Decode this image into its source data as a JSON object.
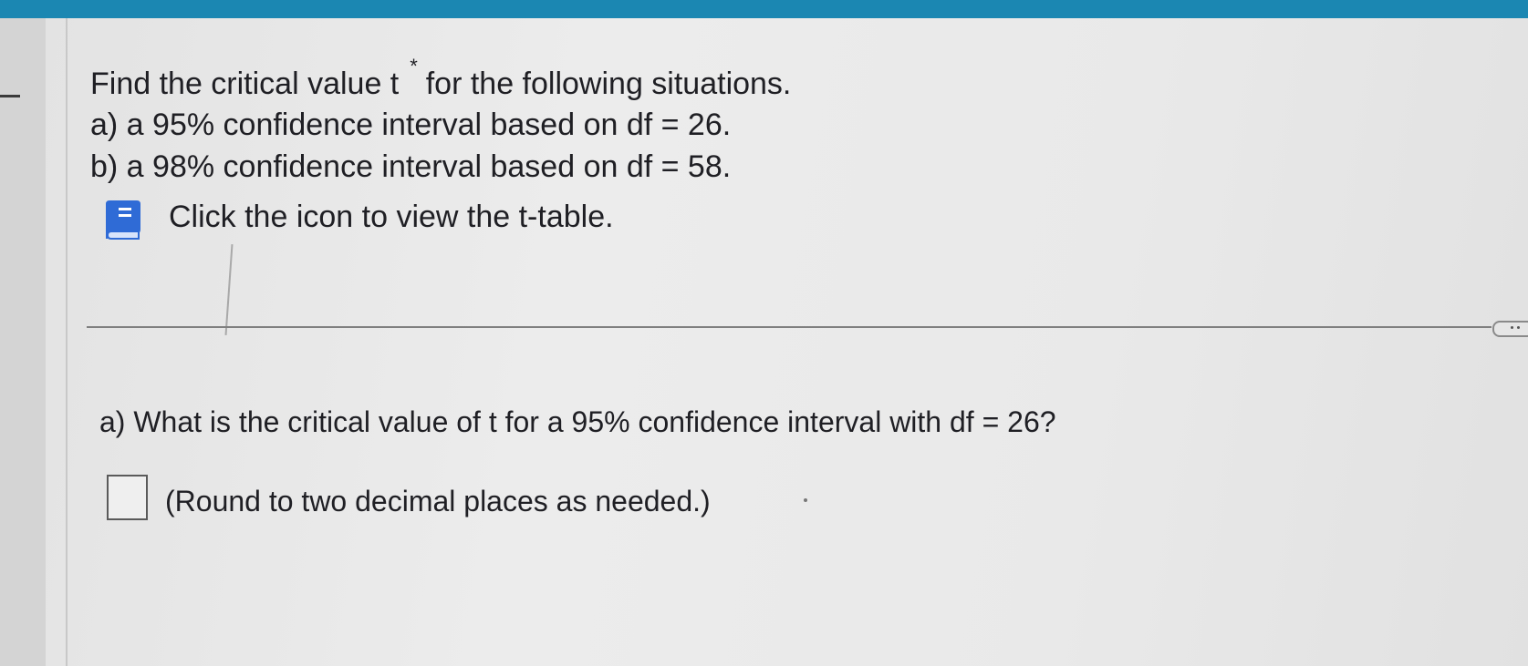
{
  "intro": {
    "part1": "Find the critical value t",
    "superscript": "*",
    "part2": "for the following situations."
  },
  "items": {
    "a": "a) a 95% confidence interval based on df = 26.",
    "b": "b) a 98% confidence interval based on df = 58."
  },
  "ttable": {
    "label": "Click the icon to view the t-table.",
    "icon": "book-icon"
  },
  "question": {
    "text": "a) What is the critical value of t for a 95% confidence interval with df = 26?",
    "answer_value": "",
    "note": "(Round to two decimal places as needed.)"
  },
  "colors": {
    "accent": "#1b87b2",
    "icon_blue": "#2f6bd6",
    "text": "#1f1f24"
  }
}
